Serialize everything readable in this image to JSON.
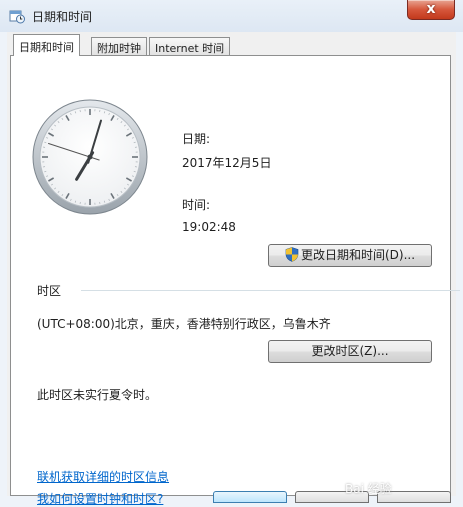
{
  "window": {
    "title": "日期和时间",
    "close_symbol": "x"
  },
  "tabs": [
    {
      "label": "日期和时间",
      "active": true
    },
    {
      "label": "附加时钟",
      "active": false
    },
    {
      "label": "Internet 时间",
      "active": false
    }
  ],
  "clock": {
    "hour": 19,
    "minute": 2,
    "second": 48
  },
  "date": {
    "label": "日期:",
    "value": "2017年12月5日"
  },
  "time": {
    "label": "时间:",
    "value": "19:02:48"
  },
  "buttons": {
    "change_datetime": "更改日期和时间(D)...",
    "change_timezone": "更改时区(Z)..."
  },
  "timezone": {
    "section_label": "时区",
    "value": "(UTC+08:00)北京，重庆，香港特别行政区，乌鲁木齐",
    "dst_note": "此时区未实行夏令时。"
  },
  "links": {
    "online_info": "联机获取详细的时区信息",
    "how_to": "我如何设置时钟和时区?"
  },
  "watermark": "Bai 经验",
  "colors": {
    "link": "#0066cc",
    "close": "#c2391c",
    "titlebar": "#dde7f3"
  }
}
